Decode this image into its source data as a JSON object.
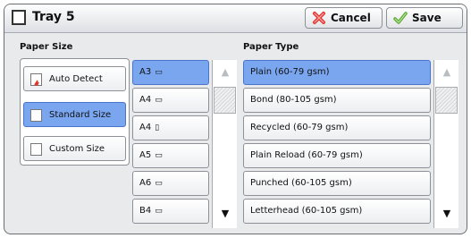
{
  "header": {
    "title": "Tray 5",
    "cancel_label": "Cancel",
    "save_label": "Save"
  },
  "paper_size": {
    "label": "Paper Size",
    "modes": [
      {
        "label": "Auto Detect",
        "selected": false
      },
      {
        "label": "Standard Size",
        "selected": true
      },
      {
        "label": "Custom Size",
        "selected": false
      }
    ],
    "sizes": [
      {
        "label": "A3",
        "orient": "▭",
        "selected": true
      },
      {
        "label": "A4",
        "orient": "▭",
        "selected": false
      },
      {
        "label": "A4",
        "orient": "▯",
        "selected": false
      },
      {
        "label": "A5",
        "orient": "▭",
        "selected": false
      },
      {
        "label": "A6",
        "orient": "▭",
        "selected": false
      },
      {
        "label": "B4",
        "orient": "▭",
        "selected": false
      }
    ]
  },
  "paper_type": {
    "label": "Paper Type",
    "items": [
      {
        "label": "Plain (60-79 gsm)",
        "selected": true
      },
      {
        "label": "Bond (80-105 gsm)",
        "selected": false
      },
      {
        "label": "Recycled (60-79 gsm)",
        "selected": false
      },
      {
        "label": "Plain Reload (60-79 gsm)",
        "selected": false
      },
      {
        "label": "Punched (60-105 gsm)",
        "selected": false
      },
      {
        "label": "Letterhead (60-105 gsm)",
        "selected": false
      }
    ]
  },
  "scroll": {
    "up": "▲",
    "down": "▼"
  },
  "colors": {
    "selected": "#7aa6ef",
    "accent_cancel": "#e0322c",
    "accent_save": "#5aa830"
  }
}
